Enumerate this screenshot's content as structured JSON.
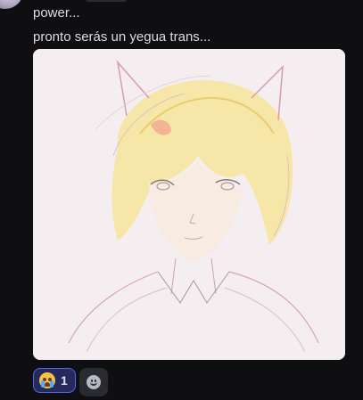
{
  "message": {
    "line1": "power...",
    "line2": "pronto serás un yegua trans...",
    "attachment_type": "image",
    "attachment_icon": "image-drawing"
  },
  "reactions": [
    {
      "emoji_name": "sob-emoji",
      "count": "1",
      "active": true
    }
  ],
  "add_reaction_icon": "add-reaction-icon",
  "colors": {
    "background": "#0f0f12",
    "text": "#dbdee1",
    "reaction_active_bg": "#27295a",
    "reaction_active_border": "#5865f2",
    "image_bg": "#f4eef0"
  }
}
